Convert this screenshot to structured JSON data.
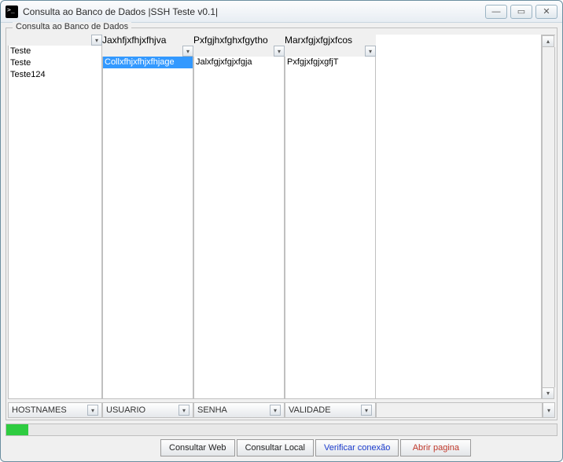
{
  "window": {
    "title": "Consulta ao Banco de Dados |SSH Teste v0.1|"
  },
  "groupbox": {
    "title": "Consulta ao Banco de Dados"
  },
  "columns": [
    {
      "header": "",
      "items": [
        "Teste",
        "Teste",
        "Teste124"
      ],
      "selectedIndex": -1,
      "footer": "HOSTNAMES"
    },
    {
      "header": "Jaxhfjxfhjxfhjva",
      "items": [
        "Collxfhjxfhjxfhjage"
      ],
      "selectedIndex": 0,
      "footer": "USUARIO"
    },
    {
      "header": "Pxfgjhxfghxfgytho",
      "items": [
        "Jalxfgjxfgjxfgja"
      ],
      "selectedIndex": -1,
      "footer": "SENHA"
    },
    {
      "header": "Marxfgjxfgjxfcos",
      "items": [
        "PxfgjxfgjxgfjT"
      ],
      "selectedIndex": -1,
      "footer": "VALIDADE"
    }
  ],
  "progress": {
    "percent": 4
  },
  "buttons": {
    "consultWeb": "Consultar Web",
    "consultLocal": "Consultar Local",
    "verify": "Verificar conexão",
    "open": "Abrir pagina"
  }
}
